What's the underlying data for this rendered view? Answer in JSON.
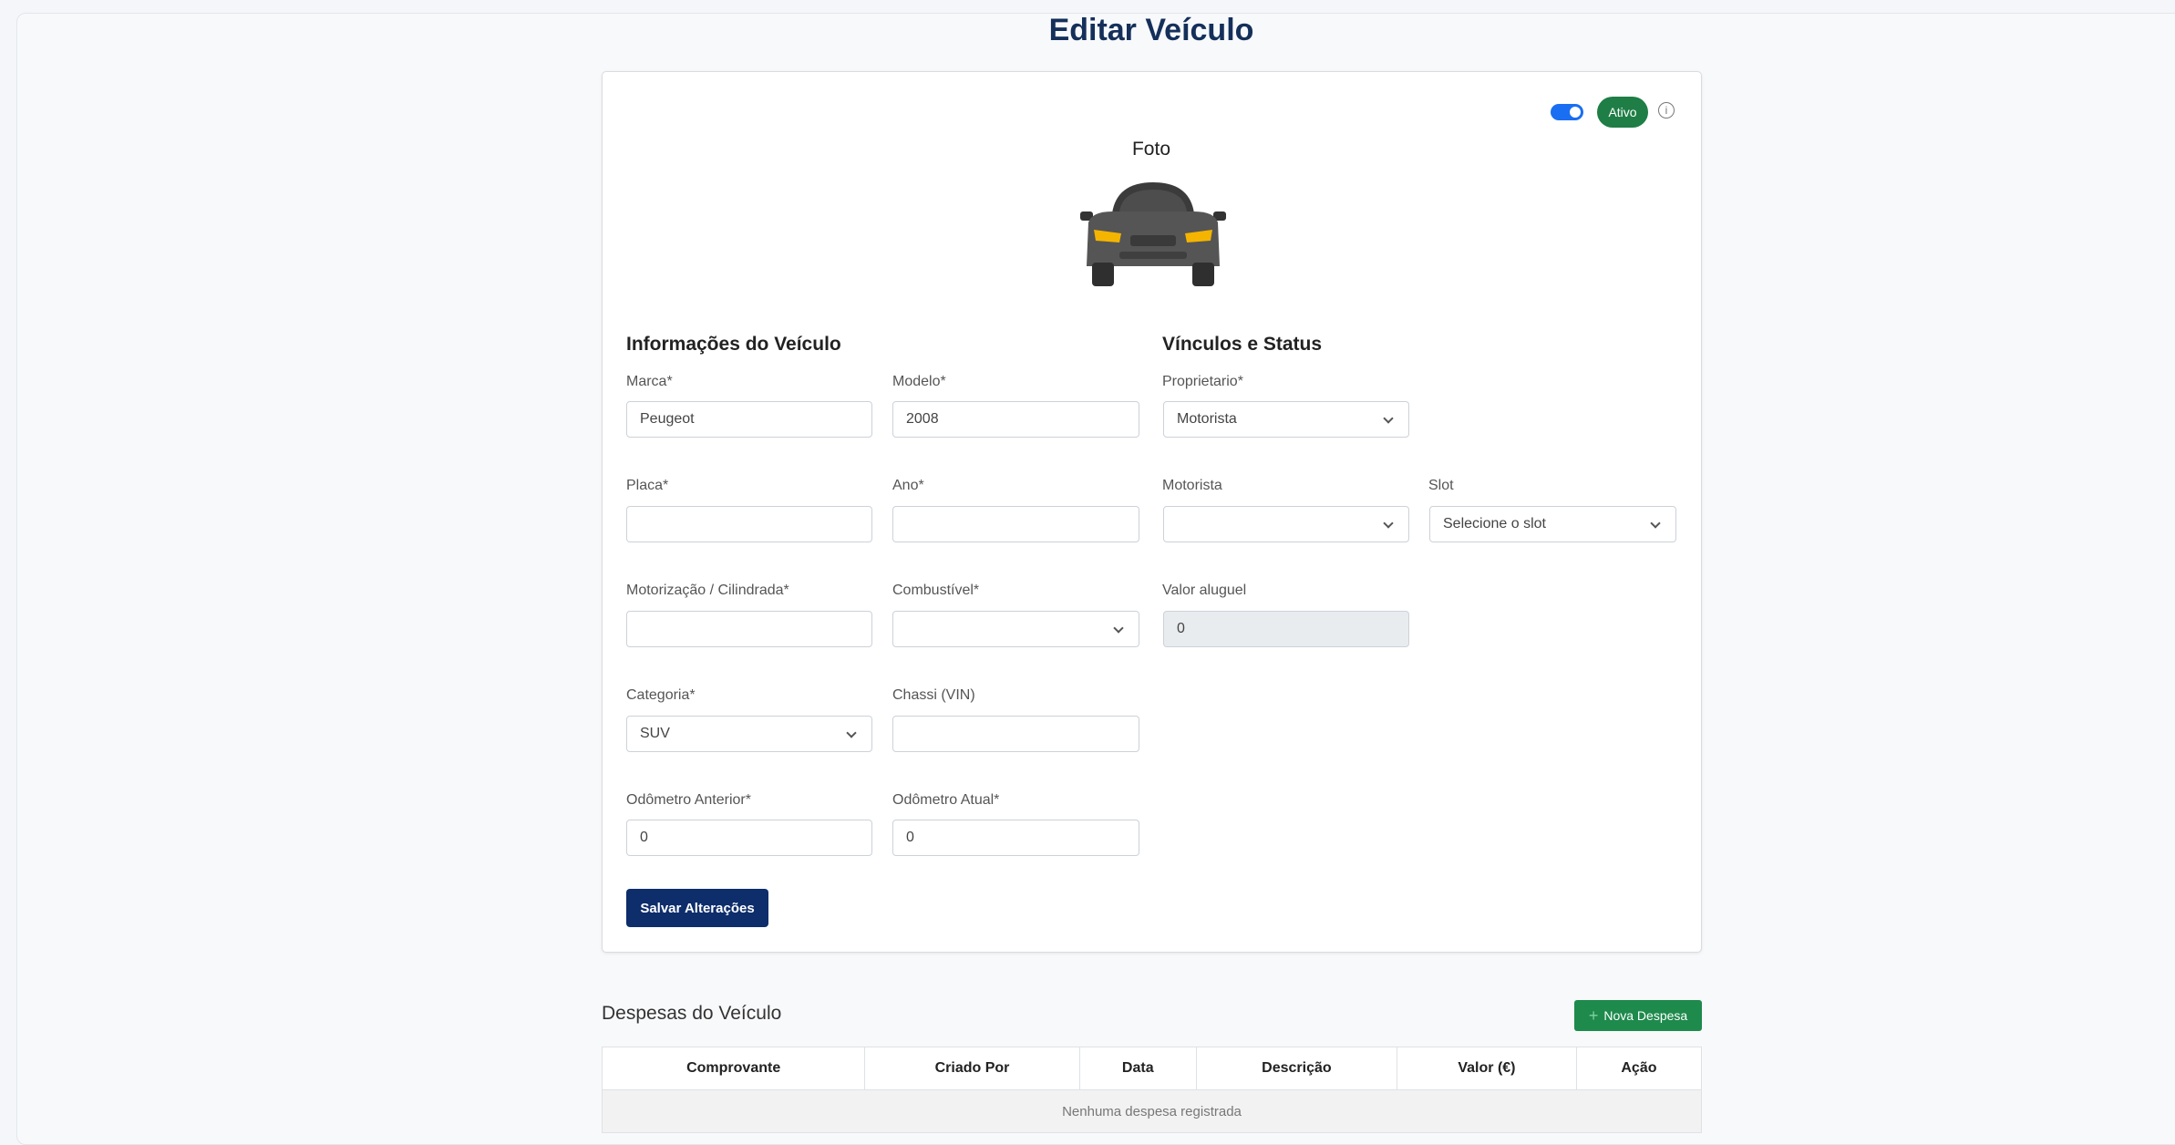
{
  "page": {
    "title": "Editar Veículo"
  },
  "status": {
    "badge": "Ativo",
    "toggle_on": true,
    "info_icon": "info-circle-icon"
  },
  "photo": {
    "label": "Foto",
    "image": "car-front-icon"
  },
  "vehicle_info": {
    "title": "Informações do Veículo",
    "marca": {
      "label": "Marca*",
      "value": "Peugeot"
    },
    "modelo": {
      "label": "Modelo*",
      "value": "2008"
    },
    "placa": {
      "label": "Placa*",
      "value": ""
    },
    "ano": {
      "label": "Ano*",
      "value": ""
    },
    "motorizacao": {
      "label": "Motorização / Cilindrada*",
      "value": ""
    },
    "combustivel": {
      "label": "Combustível*",
      "value": ""
    },
    "categoria": {
      "label": "Categoria*",
      "value": "SUV"
    },
    "chassi": {
      "label": "Chassi (VIN)",
      "value": ""
    },
    "odometro_anterior": {
      "label": "Odômetro Anterior*",
      "value": "0"
    },
    "odometro_atual": {
      "label": "Odômetro Atual*",
      "value": "0"
    }
  },
  "links_status": {
    "title": "Vínculos e Status",
    "proprietario": {
      "label": "Proprietario*",
      "value": "Motorista"
    },
    "motorista": {
      "label": "Motorista",
      "value": ""
    },
    "slot": {
      "label": "Slot",
      "value": "Selecione o slot"
    },
    "valor_aluguel": {
      "label": "Valor aluguel",
      "value": "0"
    }
  },
  "actions": {
    "save": "Salvar Alterações"
  },
  "expenses": {
    "title": "Despesas do Veículo",
    "new_button": "Nova Despesa",
    "columns": [
      "Comprovante",
      "Criado Por",
      "Data",
      "Descrição",
      "Valor (€)",
      "Ação"
    ],
    "empty": "Nenhuma despesa registrada"
  },
  "colors": {
    "primary": "#0d2d6b",
    "success": "#1e8a4c",
    "toggle": "#1a6ef2",
    "title": "#14305a"
  }
}
